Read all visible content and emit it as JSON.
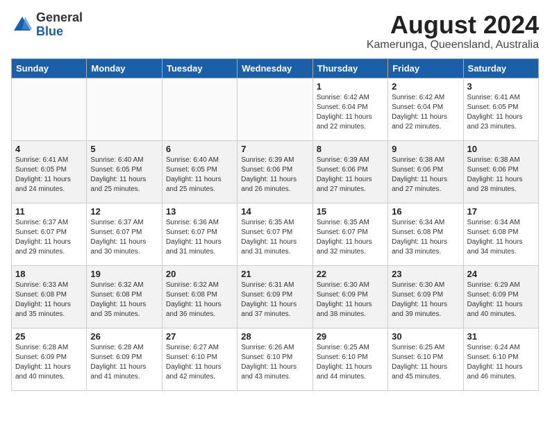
{
  "header": {
    "logo_general": "General",
    "logo_blue": "Blue",
    "month_year": "August 2024",
    "location": "Kamerunga, Queensland, Australia"
  },
  "weekdays": [
    "Sunday",
    "Monday",
    "Tuesday",
    "Wednesday",
    "Thursday",
    "Friday",
    "Saturday"
  ],
  "weeks": [
    [
      {
        "date": "",
        "sunrise": "",
        "sunset": "",
        "daylight": ""
      },
      {
        "date": "",
        "sunrise": "",
        "sunset": "",
        "daylight": ""
      },
      {
        "date": "",
        "sunrise": "",
        "sunset": "",
        "daylight": ""
      },
      {
        "date": "",
        "sunrise": "",
        "sunset": "",
        "daylight": ""
      },
      {
        "date": "1",
        "sunrise": "Sunrise: 6:42 AM",
        "sunset": "Sunset: 6:04 PM",
        "daylight": "Daylight: 11 hours and 22 minutes."
      },
      {
        "date": "2",
        "sunrise": "Sunrise: 6:42 AM",
        "sunset": "Sunset: 6:04 PM",
        "daylight": "Daylight: 11 hours and 22 minutes."
      },
      {
        "date": "3",
        "sunrise": "Sunrise: 6:41 AM",
        "sunset": "Sunset: 6:05 PM",
        "daylight": "Daylight: 11 hours and 23 minutes."
      }
    ],
    [
      {
        "date": "4",
        "sunrise": "Sunrise: 6:41 AM",
        "sunset": "Sunset: 6:05 PM",
        "daylight": "Daylight: 11 hours and 24 minutes."
      },
      {
        "date": "5",
        "sunrise": "Sunrise: 6:40 AM",
        "sunset": "Sunset: 6:05 PM",
        "daylight": "Daylight: 11 hours and 25 minutes."
      },
      {
        "date": "6",
        "sunrise": "Sunrise: 6:40 AM",
        "sunset": "Sunset: 6:05 PM",
        "daylight": "Daylight: 11 hours and 25 minutes."
      },
      {
        "date": "7",
        "sunrise": "Sunrise: 6:39 AM",
        "sunset": "Sunset: 6:06 PM",
        "daylight": "Daylight: 11 hours and 26 minutes."
      },
      {
        "date": "8",
        "sunrise": "Sunrise: 6:39 AM",
        "sunset": "Sunset: 6:06 PM",
        "daylight": "Daylight: 11 hours and 27 minutes."
      },
      {
        "date": "9",
        "sunrise": "Sunrise: 6:38 AM",
        "sunset": "Sunset: 6:06 PM",
        "daylight": "Daylight: 11 hours and 27 minutes."
      },
      {
        "date": "10",
        "sunrise": "Sunrise: 6:38 AM",
        "sunset": "Sunset: 6:06 PM",
        "daylight": "Daylight: 11 hours and 28 minutes."
      }
    ],
    [
      {
        "date": "11",
        "sunrise": "Sunrise: 6:37 AM",
        "sunset": "Sunset: 6:07 PM",
        "daylight": "Daylight: 11 hours and 29 minutes."
      },
      {
        "date": "12",
        "sunrise": "Sunrise: 6:37 AM",
        "sunset": "Sunset: 6:07 PM",
        "daylight": "Daylight: 11 hours and 30 minutes."
      },
      {
        "date": "13",
        "sunrise": "Sunrise: 6:36 AM",
        "sunset": "Sunset: 6:07 PM",
        "daylight": "Daylight: 11 hours and 31 minutes."
      },
      {
        "date": "14",
        "sunrise": "Sunrise: 6:35 AM",
        "sunset": "Sunset: 6:07 PM",
        "daylight": "Daylight: 11 hours and 31 minutes."
      },
      {
        "date": "15",
        "sunrise": "Sunrise: 6:35 AM",
        "sunset": "Sunset: 6:07 PM",
        "daylight": "Daylight: 11 hours and 32 minutes."
      },
      {
        "date": "16",
        "sunrise": "Sunrise: 6:34 AM",
        "sunset": "Sunset: 6:08 PM",
        "daylight": "Daylight: 11 hours and 33 minutes."
      },
      {
        "date": "17",
        "sunrise": "Sunrise: 6:34 AM",
        "sunset": "Sunset: 6:08 PM",
        "daylight": "Daylight: 11 hours and 34 minutes."
      }
    ],
    [
      {
        "date": "18",
        "sunrise": "Sunrise: 6:33 AM",
        "sunset": "Sunset: 6:08 PM",
        "daylight": "Daylight: 11 hours and 35 minutes."
      },
      {
        "date": "19",
        "sunrise": "Sunrise: 6:32 AM",
        "sunset": "Sunset: 6:08 PM",
        "daylight": "Daylight: 11 hours and 35 minutes."
      },
      {
        "date": "20",
        "sunrise": "Sunrise: 6:32 AM",
        "sunset": "Sunset: 6:08 PM",
        "daylight": "Daylight: 11 hours and 36 minutes."
      },
      {
        "date": "21",
        "sunrise": "Sunrise: 6:31 AM",
        "sunset": "Sunset: 6:09 PM",
        "daylight": "Daylight: 11 hours and 37 minutes."
      },
      {
        "date": "22",
        "sunrise": "Sunrise: 6:30 AM",
        "sunset": "Sunset: 6:09 PM",
        "daylight": "Daylight: 11 hours and 38 minutes."
      },
      {
        "date": "23",
        "sunrise": "Sunrise: 6:30 AM",
        "sunset": "Sunset: 6:09 PM",
        "daylight": "Daylight: 11 hours and 39 minutes."
      },
      {
        "date": "24",
        "sunrise": "Sunrise: 6:29 AM",
        "sunset": "Sunset: 6:09 PM",
        "daylight": "Daylight: 11 hours and 40 minutes."
      }
    ],
    [
      {
        "date": "25",
        "sunrise": "Sunrise: 6:28 AM",
        "sunset": "Sunset: 6:09 PM",
        "daylight": "Daylight: 11 hours and 40 minutes."
      },
      {
        "date": "26",
        "sunrise": "Sunrise: 6:28 AM",
        "sunset": "Sunset: 6:09 PM",
        "daylight": "Daylight: 11 hours and 41 minutes."
      },
      {
        "date": "27",
        "sunrise": "Sunrise: 6:27 AM",
        "sunset": "Sunset: 6:10 PM",
        "daylight": "Daylight: 11 hours and 42 minutes."
      },
      {
        "date": "28",
        "sunrise": "Sunrise: 6:26 AM",
        "sunset": "Sunset: 6:10 PM",
        "daylight": "Daylight: 11 hours and 43 minutes."
      },
      {
        "date": "29",
        "sunrise": "Sunrise: 6:25 AM",
        "sunset": "Sunset: 6:10 PM",
        "daylight": "Daylight: 11 hours and 44 minutes."
      },
      {
        "date": "30",
        "sunrise": "Sunrise: 6:25 AM",
        "sunset": "Sunset: 6:10 PM",
        "daylight": "Daylight: 11 hours and 45 minutes."
      },
      {
        "date": "31",
        "sunrise": "Sunrise: 6:24 AM",
        "sunset": "Sunset: 6:10 PM",
        "daylight": "Daylight: 11 hours and 46 minutes."
      }
    ]
  ]
}
